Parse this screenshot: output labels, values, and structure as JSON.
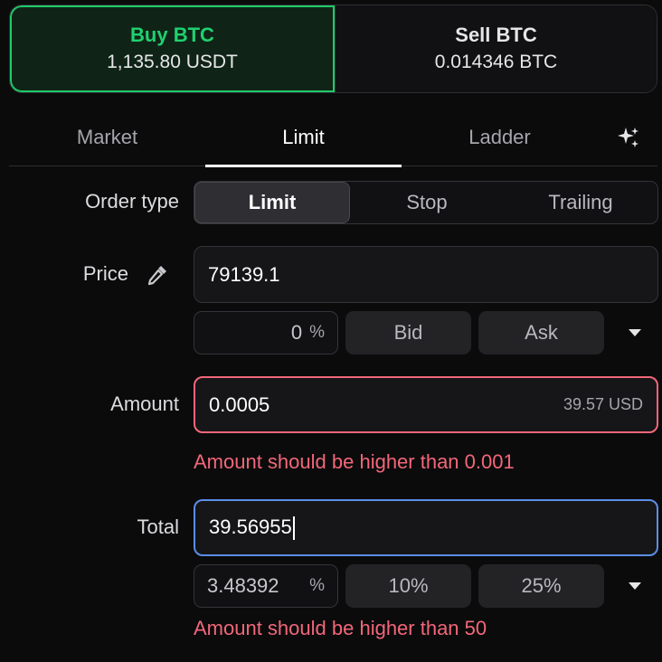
{
  "side_toggle": {
    "buy": {
      "label": "Buy BTC",
      "sub": "1,135.80 USDT"
    },
    "sell": {
      "label": "Sell BTC",
      "sub": "0.014346 BTC"
    }
  },
  "tabs": [
    {
      "label": "Market"
    },
    {
      "label": "Limit"
    },
    {
      "label": "Ladder"
    }
  ],
  "tab_icon": "sparkles-icon",
  "order_type": {
    "label": "Order type",
    "options": [
      "Limit",
      "Stop",
      "Trailing"
    ],
    "selected": "Limit"
  },
  "price": {
    "label": "Price",
    "icon": "eyedropper-icon",
    "value": "79139.1",
    "offset_value": "0",
    "offset_unit": "%",
    "chips": [
      "Bid",
      "Ask"
    ]
  },
  "amount": {
    "label": "Amount",
    "value": "0.0005",
    "suffix": "39.57 USD",
    "error": "Amount should be higher than 0.001"
  },
  "total": {
    "label": "Total",
    "value": "39.56955",
    "pct_value": "3.48392",
    "pct_unit": "%",
    "chips": [
      "10%",
      "25%"
    ],
    "error": "Amount should be higher than 50"
  },
  "colors": {
    "buy_accent": "#20d070",
    "error": "#f26779",
    "focus": "#5b8ee6"
  }
}
